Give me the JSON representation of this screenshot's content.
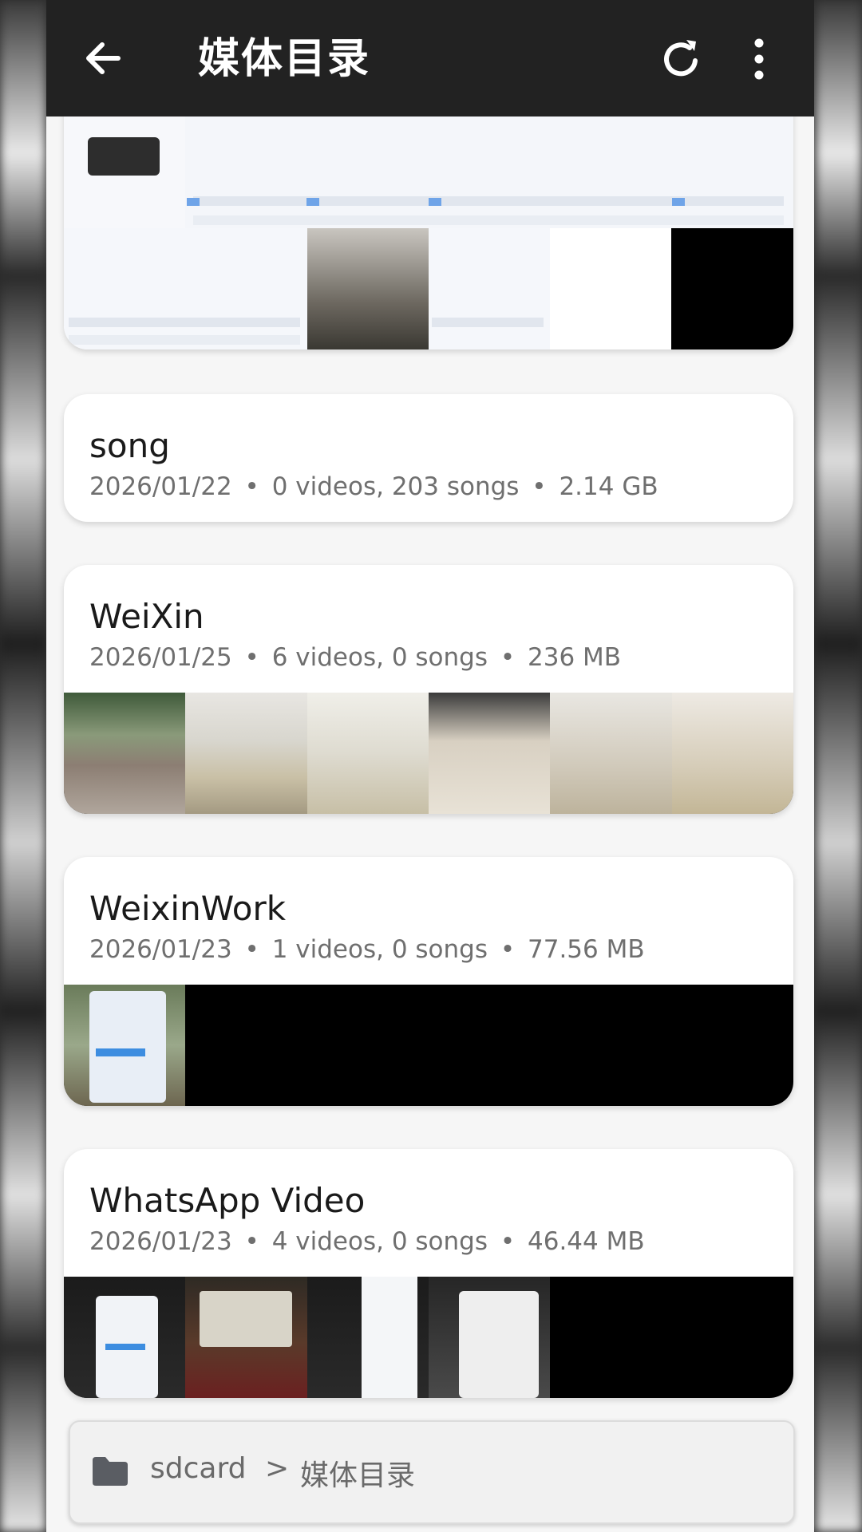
{
  "toolbar": {
    "title": "媒体目录",
    "back_icon": "arrow-left-icon",
    "refresh_icon": "refresh-icon",
    "more_icon": "more-vertical-icon"
  },
  "folders": [
    {
      "name": "song",
      "date": "2026/01/22",
      "counts": "0 videos, 203 songs",
      "size": "2.14 GB"
    },
    {
      "name": "WeiXin",
      "date": "2026/01/25",
      "counts": "6 videos, 0 songs",
      "size": "236 MB"
    },
    {
      "name": "WeixinWork",
      "date": "2026/01/23",
      "counts": "1 videos, 0 songs",
      "size": "77.56 MB"
    },
    {
      "name": "WhatsApp Video",
      "date": "2026/01/23",
      "counts": "4 videos, 0 songs",
      "size": "46.44 MB"
    }
  ],
  "separator": "•",
  "path": {
    "icon": "folder-icon",
    "root": "sdcard",
    "chevron": ">",
    "current": "媒体目录"
  },
  "colors": {
    "toolbar_bg": "#222222",
    "card_bg": "#ffffff",
    "page_bg": "#f6f6f6"
  }
}
